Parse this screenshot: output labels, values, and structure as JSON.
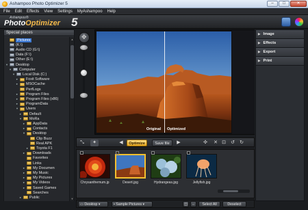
{
  "window": {
    "title": "Ashampoo Photo Optimizer 5"
  },
  "menu": [
    "File",
    "Edit",
    "Effects",
    "View",
    "Settings",
    "MyAshampoo",
    "Help"
  ],
  "logo": {
    "brand": "Ashampoo®",
    "name_part1": "Photo",
    "name_part2": "Optimizer",
    "version": "5"
  },
  "left_panel": {
    "title": "Special places",
    "tree": [
      {
        "label": "Pictures",
        "icon": "folder-icon",
        "selected": true
      },
      {
        "label": "(K:\\)",
        "icon": "drive-icon"
      },
      {
        "label": "Audio CD (G:\\)",
        "icon": "cd-icon"
      },
      {
        "label": "Data (F:\\)",
        "icon": "drive-icon"
      },
      {
        "label": "Other (E:\\)",
        "icon": "drive-icon"
      },
      {
        "label": "Desktop",
        "icon": "desktop-icon"
      },
      {
        "label": "Computer",
        "icon": "computer-icon"
      },
      {
        "label": "Local Disk (C:)",
        "icon": "drive-icon"
      },
      {
        "label": "Foxit Software",
        "icon": "folder-icon"
      },
      {
        "label": "MSOCache",
        "icon": "folder-icon"
      },
      {
        "label": "PerfLogs",
        "icon": "folder-icon"
      },
      {
        "label": "Program Files",
        "icon": "folder-icon"
      },
      {
        "label": "Program Files (x86)",
        "icon": "folder-icon"
      },
      {
        "label": "ProgramData",
        "icon": "folder-icon"
      },
      {
        "label": "Users",
        "icon": "folder-icon"
      },
      {
        "label": "Default",
        "icon": "folder-icon"
      },
      {
        "label": "MoRa",
        "icon": "folder-icon"
      },
      {
        "label": "AppData",
        "icon": "folder-icon"
      },
      {
        "label": "Contacts",
        "icon": "folder-icon"
      },
      {
        "label": "Desktop",
        "icon": "folder-icon"
      },
      {
        "label": "Clip Buzz",
        "icon": "folder-icon"
      },
      {
        "label": "Real APK",
        "icon": "folder-icon"
      },
      {
        "label": "Toyota F1",
        "icon": "folder-icon"
      },
      {
        "label": "Downloads",
        "icon": "folder-icon"
      },
      {
        "label": "Favorites",
        "icon": "folder-icon"
      },
      {
        "label": "Links",
        "icon": "folder-icon"
      },
      {
        "label": "My Documen",
        "icon": "folder-icon"
      },
      {
        "label": "My Music",
        "icon": "folder-icon"
      },
      {
        "label": "My Pictures",
        "icon": "folder-icon"
      },
      {
        "label": "My Videos",
        "icon": "folder-icon"
      },
      {
        "label": "Saved Games",
        "icon": "folder-icon"
      },
      {
        "label": "Searches",
        "icon": "folder-icon"
      },
      {
        "label": "Public",
        "icon": "folder-icon"
      }
    ]
  },
  "viewer": {
    "original_label": "Original",
    "optimized_label": "Optimized"
  },
  "right_panel": {
    "sections": [
      "Image",
      "Effects",
      "Export",
      "Print"
    ]
  },
  "toolbar": {
    "optimize_label": "Optimize",
    "save_label": "Save file"
  },
  "thumbnails": [
    {
      "caption": "Chrysanthemum.jp",
      "selected": false
    },
    {
      "caption": "Desert.jpg",
      "selected": true
    },
    {
      "caption": "Hydrangeas.jpg",
      "selected": false
    },
    {
      "caption": "Jellyfish.jpg",
      "selected": false
    }
  ],
  "footer": {
    "location": "Desktop",
    "folder": "Sample Pictures",
    "select_all": "Select All",
    "deselect": "Deselect"
  },
  "colors": {
    "accent": "#f4c030",
    "selection": "#3a76d0",
    "background": "#1b1d20"
  }
}
